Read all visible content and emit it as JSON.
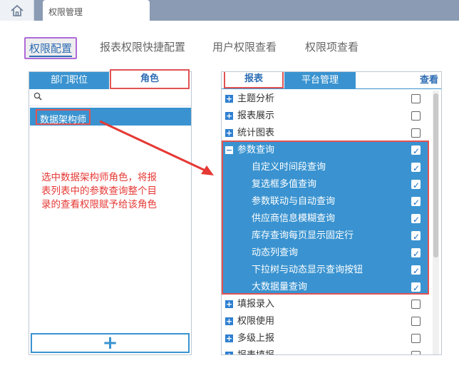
{
  "window": {
    "tab_title": "权限管理"
  },
  "subtabs": [
    "权限配置",
    "报表权限快捷配置",
    "用户权限查看",
    "权限项查看"
  ],
  "left_panel": {
    "tabs": [
      "部门职位",
      "角色"
    ],
    "roles": [
      "数据架构师"
    ],
    "add_label": "+"
  },
  "annotation": "选中数据架构师角色，将报表列表中的参数查询整个目录的查看权限赋予给该角色",
  "right_panel": {
    "tabs": [
      "报表",
      "平台管理"
    ],
    "column_label": "查看",
    "tree": [
      {
        "label": "主题分析",
        "level": 0,
        "expanded": false,
        "checked": false
      },
      {
        "label": "报表展示",
        "level": 0,
        "expanded": false,
        "checked": false
      },
      {
        "label": "统计图表",
        "level": 0,
        "expanded": false,
        "checked": false
      },
      {
        "label": "参数查询",
        "level": 0,
        "expanded": true,
        "checked": true
      },
      {
        "label": "自定义时间段查询",
        "level": 1,
        "checked": true
      },
      {
        "label": "复选框多值查询",
        "level": 1,
        "checked": true
      },
      {
        "label": "参数联动与自动查询",
        "level": 1,
        "checked": true
      },
      {
        "label": "供应商信息模糊查询",
        "level": 1,
        "checked": true
      },
      {
        "label": "库存查询每页显示固定行",
        "level": 1,
        "checked": true
      },
      {
        "label": "动态列查询",
        "level": 1,
        "checked": true
      },
      {
        "label": "下拉树与动态显示查询按钮",
        "level": 1,
        "checked": true
      },
      {
        "label": "大数据量查询",
        "level": 1,
        "checked": true
      },
      {
        "label": "填报录入",
        "level": 0,
        "expanded": false,
        "checked": false
      },
      {
        "label": "权限使用",
        "level": 0,
        "expanded": false,
        "checked": false
      },
      {
        "label": "多级上报",
        "level": 0,
        "expanded": false,
        "checked": false
      },
      {
        "label": "报表填报",
        "level": 0,
        "expanded": false,
        "checked": false
      }
    ]
  },
  "colors": {
    "accent": "#3a93d0",
    "highlight": "#e15353",
    "purple": "#b06ad9"
  }
}
